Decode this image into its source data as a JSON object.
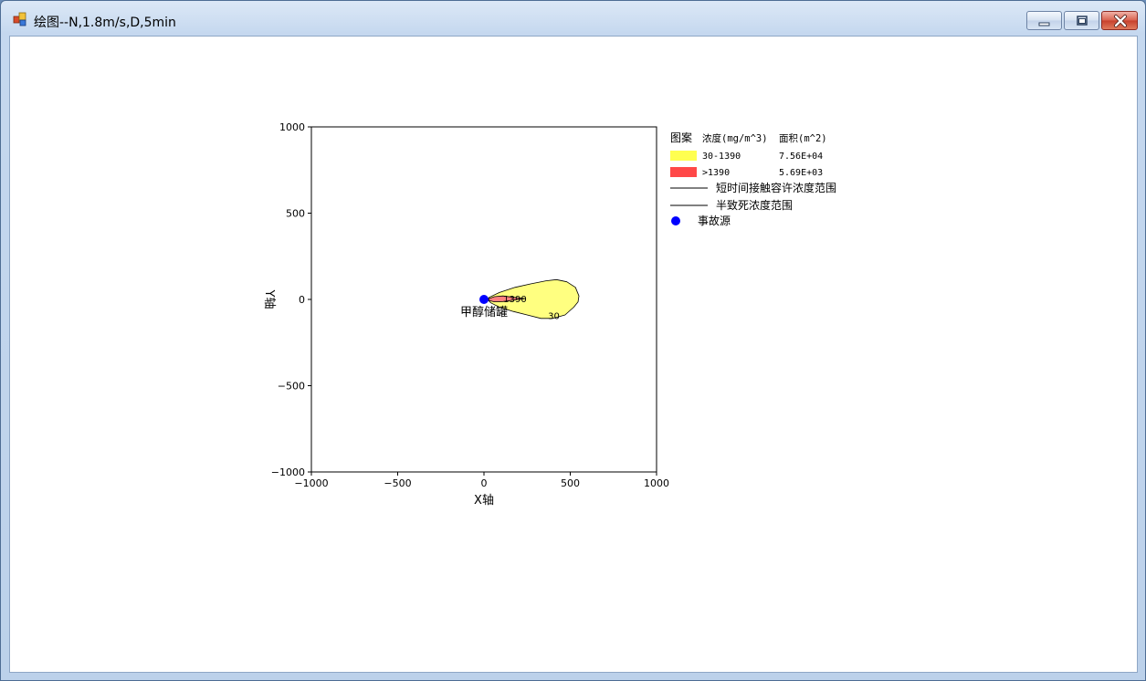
{
  "window": {
    "title": "绘图--N,1.8m/s,D,5min",
    "min_icon": "minimize-icon",
    "max_icon": "maximize-icon",
    "close_icon": "close-icon"
  },
  "chart_data": {
    "type": "contour",
    "xlabel": "X轴",
    "ylabel": "Y轴",
    "xlim": [
      -1000,
      1000
    ],
    "ylim": [
      -1000,
      1000
    ],
    "xticks": [
      -1000,
      -500,
      0,
      500,
      1000
    ],
    "yticks": [
      -1000,
      -500,
      0,
      500,
      1000
    ],
    "xtick_labels": [
      "−1000",
      "−500",
      "0",
      "500",
      "1000"
    ],
    "ytick_labels": [
      "1000",
      "500",
      "0",
      "−500",
      "−1000"
    ],
    "source": {
      "x": 0,
      "y": 0,
      "label": "甲醇储罐",
      "color": "#0000ff"
    },
    "contours": [
      {
        "label": "30",
        "color": "#ffff80",
        "points": [
          [
            30,
            12
          ],
          [
            90,
            40
          ],
          [
            180,
            70
          ],
          [
            270,
            90
          ],
          [
            360,
            108
          ],
          [
            420,
            115
          ],
          [
            480,
            102
          ],
          [
            530,
            70
          ],
          [
            550,
            20
          ],
          [
            545,
            -15
          ],
          [
            520,
            -45
          ],
          [
            470,
            -90
          ],
          [
            400,
            -110
          ],
          [
            330,
            -110
          ],
          [
            250,
            -90
          ],
          [
            170,
            -70
          ],
          [
            90,
            -45
          ],
          [
            40,
            -20
          ],
          [
            20,
            0
          ]
        ]
      },
      {
        "label": "1390",
        "color": "#ff8080",
        "points": [
          [
            28,
            4
          ],
          [
            60,
            16
          ],
          [
            110,
            20
          ],
          [
            170,
            12
          ],
          [
            240,
            5
          ],
          [
            170,
            -4
          ],
          [
            110,
            -12
          ],
          [
            60,
            -14
          ],
          [
            28,
            -6
          ]
        ]
      }
    ],
    "contour_labels": [
      {
        "text": "1390",
        "x": 180,
        "y": -15
      },
      {
        "text": "30",
        "x": 405,
        "y": -115
      }
    ],
    "legend": {
      "header": {
        "pattern": "图案",
        "conc": "浓度(mg/m^3)",
        "area": "面积(m^2)"
      },
      "rows": [
        {
          "color": "#ffff50",
          "range": "30-1390",
          "area": "7.56E+04"
        },
        {
          "color": "#ff4848",
          "range": ">1390",
          "area": "5.69E+03"
        }
      ],
      "line_items": [
        "短时间接触容许浓度范围",
        "半致死浓度范围"
      ],
      "source_item": "事故源"
    }
  }
}
